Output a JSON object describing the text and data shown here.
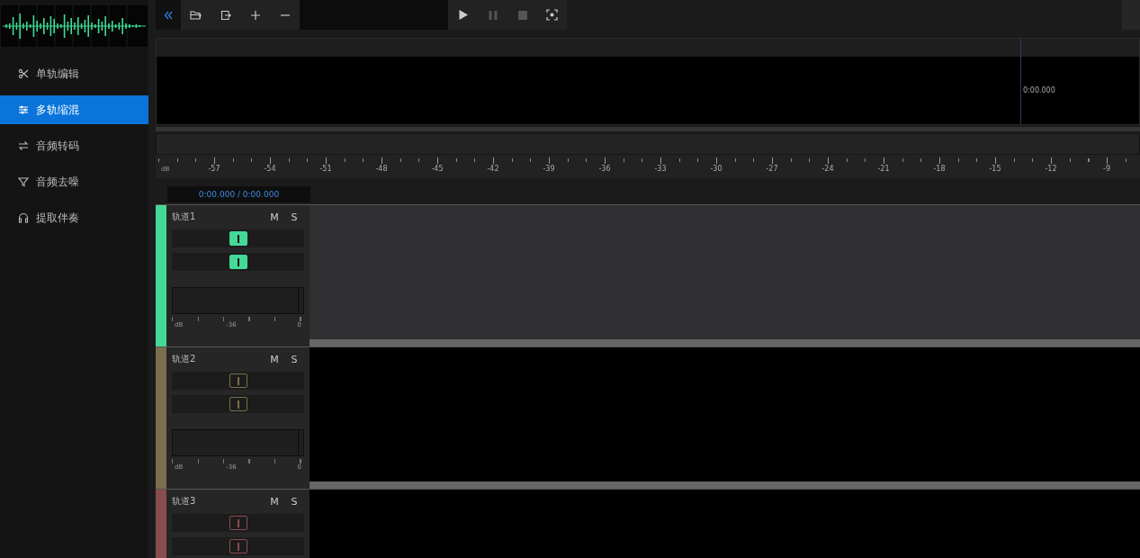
{
  "sidebar": {
    "items": [
      {
        "label": "单轨编辑",
        "selected": false
      },
      {
        "label": "多轨缩混",
        "selected": true
      },
      {
        "label": "音频转码",
        "selected": false
      },
      {
        "label": "音频去噪",
        "selected": false
      },
      {
        "label": "提取伴奏",
        "selected": false
      }
    ]
  },
  "overview": {
    "time": "0:00.000"
  },
  "ruler": {
    "unit": "dB",
    "labels": [
      "-57",
      "-54",
      "-51",
      "-48",
      "-45",
      "-42",
      "-39",
      "-36",
      "-33",
      "-30",
      "-27",
      "-24",
      "-21",
      "-18",
      "-15",
      "-12",
      "-9"
    ]
  },
  "time_display": "0:00.000 / 0:00.000",
  "tracks": [
    {
      "name": "轨道1",
      "color": "#45d998",
      "selected": true,
      "mute_button": "M",
      "solo_button": "S",
      "volume": {
        "level": 0.5
      },
      "pan": {
        "level": 0.5
      },
      "meter_scale": [
        "dB",
        "-36",
        "0"
      ]
    },
    {
      "name": "轨道2",
      "color": "#7a6e4c",
      "selected": false,
      "mute_button": "M",
      "solo_button": "S",
      "volume": {
        "level": 0.5
      },
      "pan": {
        "level": 0.5
      },
      "meter_scale": [
        "dB",
        "-36",
        "0"
      ]
    },
    {
      "name": "轨道3",
      "color": "#8a4d4d",
      "selected": false,
      "mute_button": "M",
      "solo_button": "S",
      "volume": {
        "level": 0.5
      },
      "pan": {
        "level": 0.5
      }
    }
  ]
}
